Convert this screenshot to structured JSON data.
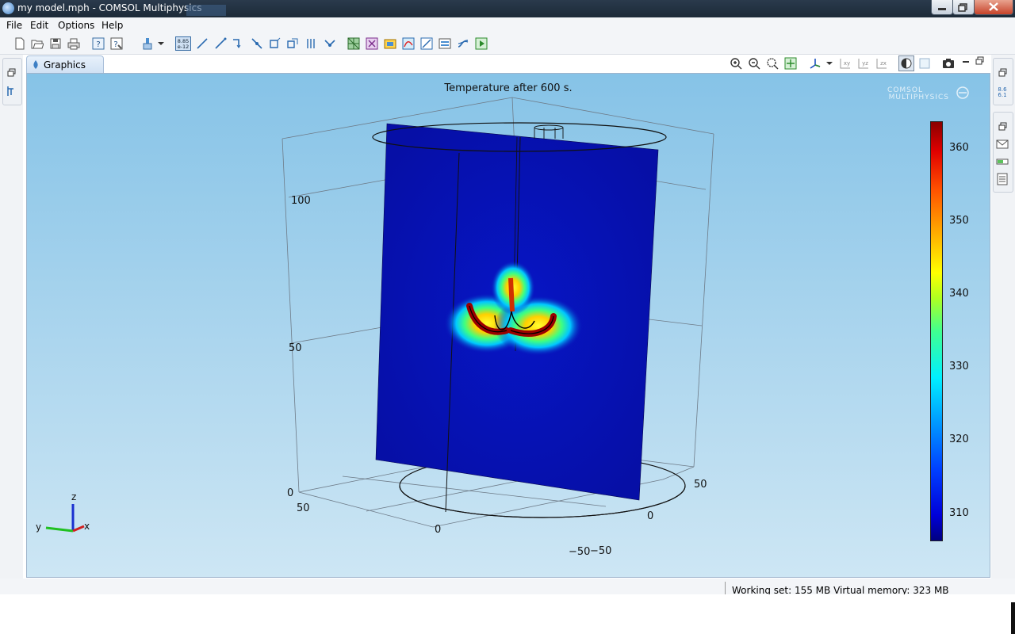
{
  "window": {
    "title": "my model.mph - COMSOL Multiphysics"
  },
  "menu": {
    "items": [
      "File",
      "Edit",
      "Options",
      "Help"
    ]
  },
  "graphics": {
    "tab_label": "Graphics",
    "plot_title": "Temperature after 600 s.",
    "logo_lines": [
      "COMSOL",
      "MULTIPHYSICS"
    ],
    "axis_labels": {
      "z_ticks": [
        "0",
        "50",
        "100"
      ],
      "y_ticks": [
        "50",
        "0",
        "−50"
      ],
      "x_ticks": [
        "50",
        "0",
        "−50"
      ]
    },
    "triad": {
      "x": "x",
      "y": "y",
      "z": "z"
    }
  },
  "colorbar": {
    "labels": [
      "360",
      "350",
      "340",
      "330",
      "320",
      "310"
    ],
    "min": 306,
    "max": 363
  },
  "status": {
    "text": "Working set: 155 MB  Virtual memory: 323 MB"
  },
  "icons": {
    "toolbar": [
      "new-icon",
      "open-icon",
      "save-icon",
      "print-icon",
      "help-icon",
      "dynamic-help-icon",
      "clear-icon",
      "parameters-icon",
      "line-icon",
      "arc-icon",
      "interpolation-icon",
      "vertex-icon",
      "polygon-icon",
      "rectangle-icon",
      "circle-icon",
      "geometry-icon",
      "mesh-icon",
      "study-icon",
      "results-icon",
      "plot-icon",
      "export-icon",
      "report-icon",
      "compute-icon"
    ],
    "graphics_toolbar": [
      "zoom-in-icon",
      "zoom-out-icon",
      "zoom-box-icon",
      "zoom-extents-icon",
      "go-to-view-icon",
      "xy-view-icon",
      "yz-view-icon",
      "zx-view-icon",
      "scene-light-icon",
      "transparency-icon",
      "screenshot-icon"
    ]
  },
  "colors": {
    "accent": "#3d7fc4",
    "viewport_top": "#86c3e7",
    "viewport_bottom": "#cde6f4",
    "panel_fill": "#0a12b8"
  }
}
